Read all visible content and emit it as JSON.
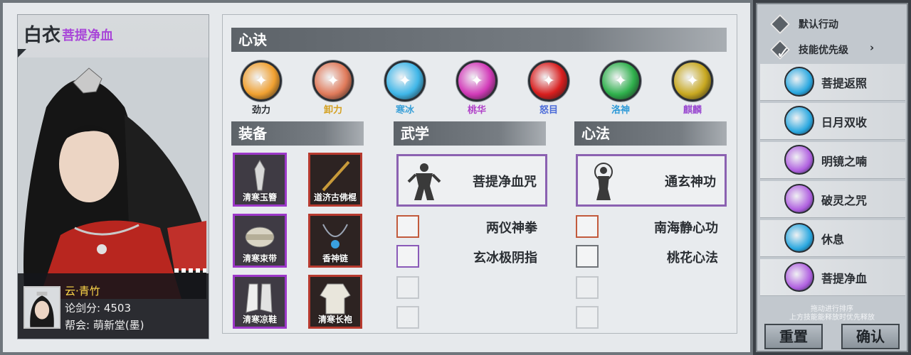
{
  "character": {
    "name": "白衣",
    "title": "菩提净血",
    "player_name": "云·青竹",
    "score_label": "论剑分: 4503",
    "guild_label": "帮会: 萌新堂(墨)"
  },
  "sections": {
    "xinjue": "心诀",
    "zhuangbei": "装备",
    "wuxue": "武学",
    "xinfa": "心法"
  },
  "xinjue": [
    {
      "label": "劲力",
      "color": "#f0a030",
      "text_color": "#2a2e33",
      "icon": "strike-figure-icon"
    },
    {
      "label": "卸力",
      "color": "#e07a5a",
      "text_color": "#d4a020",
      "icon": "spiral-icon"
    },
    {
      "label": "寒冰",
      "color": "#3fb6e8",
      "text_color": "#3aa0d8",
      "icon": "ice-crystal-icon"
    },
    {
      "label": "桃华",
      "color": "#d23ab8",
      "text_color": "#b040c8",
      "icon": "blossom-icon"
    },
    {
      "label": "怒目",
      "color": "#d81e1e",
      "text_color": "#4a6ad8",
      "icon": "rage-icon"
    },
    {
      "label": "洛神",
      "color": "#2fb04c",
      "text_color": "#2e9ad8",
      "icon": "dancer-icon"
    },
    {
      "label": "麒麟",
      "color": "#c8a820",
      "text_color": "#9a4ad0",
      "icon": "qilin-icon"
    }
  ],
  "equipment": [
    {
      "label": "清寒玉簪",
      "rarity": "purple",
      "icon": "hairpin-icon"
    },
    {
      "label": "道济古佛棍",
      "rarity": "red",
      "icon": "staff-icon"
    },
    {
      "label": "清寒束带",
      "rarity": "purple",
      "icon": "belt-icon"
    },
    {
      "label": "香神链",
      "rarity": "red",
      "icon": "necklace-icon"
    },
    {
      "label": "清寒凉鞋",
      "rarity": "purple",
      "icon": "boots-icon"
    },
    {
      "label": "清寒长袍",
      "rarity": "red",
      "icon": "robe-icon"
    }
  ],
  "wuxue": {
    "main": "菩提净血咒",
    "list": [
      "两仪神拳",
      "玄冰极阴指"
    ]
  },
  "xinfa": {
    "main": "通玄神功",
    "list": [
      "南海静心功",
      "桃花心法"
    ]
  },
  "right_panel": {
    "default_action": "默认行动",
    "skill_priority": "技能优先级",
    "chevron": "›",
    "priority": [
      {
        "label": "菩提返照",
        "color": "#2aa8e0"
      },
      {
        "label": "日月双收",
        "color": "#2aa8e0"
      },
      {
        "label": "明镜之喃",
        "color": "#b060e0"
      },
      {
        "label": "破灵之咒",
        "color": "#b060e0"
      },
      {
        "label": "休息",
        "color": "#2aa8e0"
      },
      {
        "label": "菩提净血",
        "color": "#b060e0"
      }
    ],
    "hint_line1": "拖动进行排序",
    "hint_line2": "上方技能能释放时优先释放",
    "reset": "重置",
    "confirm": "确认"
  }
}
